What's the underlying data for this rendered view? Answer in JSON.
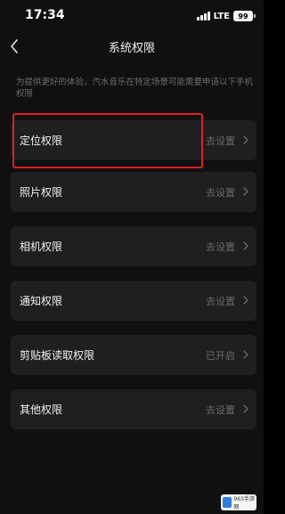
{
  "status_bar": {
    "time": "17:34",
    "network": "LTE",
    "battery": "99"
  },
  "header": {
    "title": "系统权限"
  },
  "notice": "为提供更好的体验，汽水音乐在特定场景可能需要申请以下手机权限",
  "permissions": [
    {
      "label": "定位权限",
      "status": "去设置"
    },
    {
      "label": "照片权限",
      "status": "去设置"
    },
    {
      "label": "相机权限",
      "status": "去设置"
    },
    {
      "label": "通知权限",
      "status": "去设置"
    },
    {
      "label": "剪贴板读取权限",
      "status": "已开启"
    },
    {
      "label": "其他权限",
      "status": "去设置"
    }
  ],
  "watermark": "963手游网",
  "colors": {
    "background": "#101010",
    "card": "#1f1f1f",
    "highlight": "#e0202a"
  }
}
